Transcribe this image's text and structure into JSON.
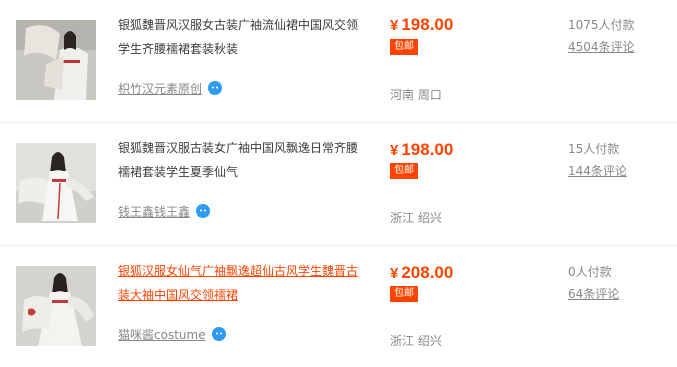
{
  "listings": [
    {
      "title": "银狐魏晋风汉服女古装广袖流仙裙中国风交领学生齐腰襦裙套装秋装",
      "shop": "枳竹汉元素原创",
      "price_symbol": "¥",
      "price": "198.00",
      "badge": "包邮",
      "location": "河南 周口",
      "sales": "1075人付款",
      "reviews": "4504条评论",
      "highlighted": false,
      "wangwang_icon": "wangwang-chat-icon",
      "thumb_palette": {
        "bg": "#c9c7c2",
        "dress": "#f2f0ec",
        "accent": "#b63a3a",
        "hair": "#2b2422"
      }
    },
    {
      "title": "银狐魏晋汉服古装女广袖中国风飘逸日常齐腰襦裙套装学生夏季仙气",
      "shop": "钱王鑫钱王鑫",
      "price_symbol": "¥",
      "price": "198.00",
      "badge": "包邮",
      "location": "浙江 绍兴",
      "sales": "15人付款",
      "reviews": "144条评论",
      "highlighted": false,
      "wangwang_icon": "wangwang-chat-icon",
      "thumb_palette": {
        "bg": "#dfe1dd",
        "dress": "#f6f6f4",
        "accent": "#c43b3b",
        "hair": "#2a2422"
      }
    },
    {
      "title": "银狐汉服女仙气广袖飘逸超仙古风学生魏晋古装大袖中国风交领襦裙",
      "shop": "猫咪酱costume",
      "price_symbol": "¥",
      "price": "208.00",
      "badge": "包邮",
      "location": "浙江 绍兴",
      "sales": "0人付款",
      "reviews": "64条评论",
      "highlighted": true,
      "wangwang_icon": "wangwang-chat-icon",
      "thumb_palette": {
        "bg": "#d4d3cf",
        "dress": "#f4f3f0",
        "accent": "#c23a38",
        "hair": "#272120"
      }
    }
  ],
  "colors": {
    "price": "#ff4400",
    "badge_bg": "#ff4400",
    "muted_text": "#888888",
    "wangwang_blue": "#2d9bf0"
  }
}
